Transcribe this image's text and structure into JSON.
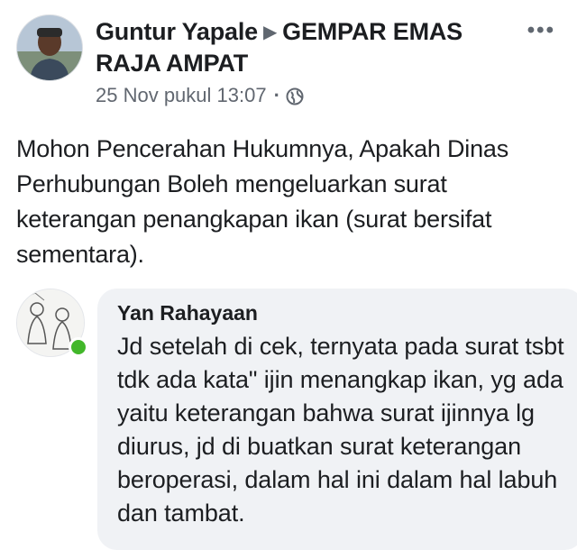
{
  "post": {
    "author": "Guntur Yapale",
    "group": "GEMPAR EMAS RAJA AMPAT",
    "timestamp": "25 Nov pukul 13:07",
    "separator": "·",
    "more_label": "•••",
    "privacy_icon": "globe-icon",
    "arrow_icon": "right-triangle-icon",
    "body": "Mohon Pencerahan Hukumnya, Apakah Dinas Perhubungan Boleh mengeluarkan surat keterangan penangkapan ikan (surat bersifat sementara)."
  },
  "comment": {
    "author": "Yan Rahayaan",
    "text": "Jd setelah di cek, ternyata pada surat tsbt tdk ada kata\" ijin menangkap ikan, yg ada yaitu keterangan bahwa surat ijinnya lg diurus, jd di buatkan surat keterangan beroperasi, dalam hal ini dalam hal labuh dan tambat.",
    "online": true
  },
  "colors": {
    "text": "#1c1e21",
    "meta": "#616770",
    "bubble": "#f0f2f5",
    "online": "#42b72a"
  }
}
